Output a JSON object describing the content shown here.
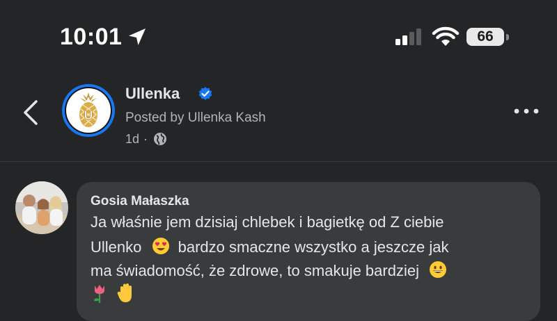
{
  "status_bar": {
    "time": "10:01",
    "battery_level": "66",
    "icons": [
      "location-arrow-icon",
      "cellular-signal-icon",
      "wifi-icon",
      "battery-icon"
    ]
  },
  "header": {
    "page_name": "Ullenka",
    "posted_by": "Posted by Ullenka Kash",
    "time_ago": "1d",
    "separator": "·",
    "privacy_icon": "globe-icon",
    "accent_color": "#1877f2"
  },
  "comment": {
    "author": "Gosia Małaszka",
    "lines": [
      "Ja właśnie jem dzisiaj chlebek i bagietkę od Z ciebie",
      "Ullenko",
      "bardzo smaczne wszystko a jeszcze jak",
      "ma świadomość, że zdrowe, to smakuje bardziej"
    ],
    "emojis": [
      "heart-eyes-emoji",
      "grinning-emoji",
      "tulip-emoji",
      "raised-hand-emoji"
    ]
  }
}
